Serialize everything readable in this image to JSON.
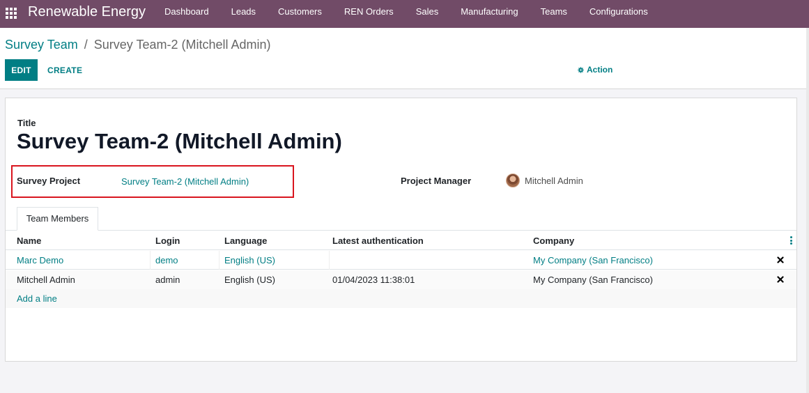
{
  "nav": {
    "brand": "Renewable Energy",
    "menu": [
      "Dashboard",
      "Leads",
      "Customers",
      "REN Orders",
      "Sales",
      "Manufacturing",
      "Teams",
      "Configurations"
    ]
  },
  "breadcrumb": {
    "parent": "Survey Team",
    "separator": "/",
    "current": "Survey Team-2 (Mitchell Admin)"
  },
  "toolbar": {
    "edit_label": "EDIT",
    "create_label": "CREATE",
    "action_label": "Action"
  },
  "form": {
    "title_label": "Title",
    "title_value": "Survey Team-2 (Mitchell Admin)",
    "survey_project_label": "Survey Project",
    "survey_project_value": "Survey Team-2 (Mitchell Admin)",
    "project_manager_label": "Project Manager",
    "project_manager_value": "Mitchell Admin"
  },
  "tabs": [
    "Team Members"
  ],
  "table": {
    "columns": [
      "Name",
      "Login",
      "Language",
      "Latest authentication",
      "Company"
    ],
    "rows": [
      {
        "name": "Marc Demo",
        "login": "demo",
        "language": "English (US)",
        "latest_auth": "",
        "company": "My Company (San Francisco)"
      },
      {
        "name": "Mitchell Admin",
        "login": "admin",
        "language": "English (US)",
        "latest_auth": "01/04/2023 11:38:01",
        "company": "My Company (San Francisco)"
      }
    ],
    "add_line_label": "Add a line"
  },
  "colors": {
    "navbar": "#714b67",
    "primary": "#017e84",
    "highlight_border": "#d9151e"
  }
}
